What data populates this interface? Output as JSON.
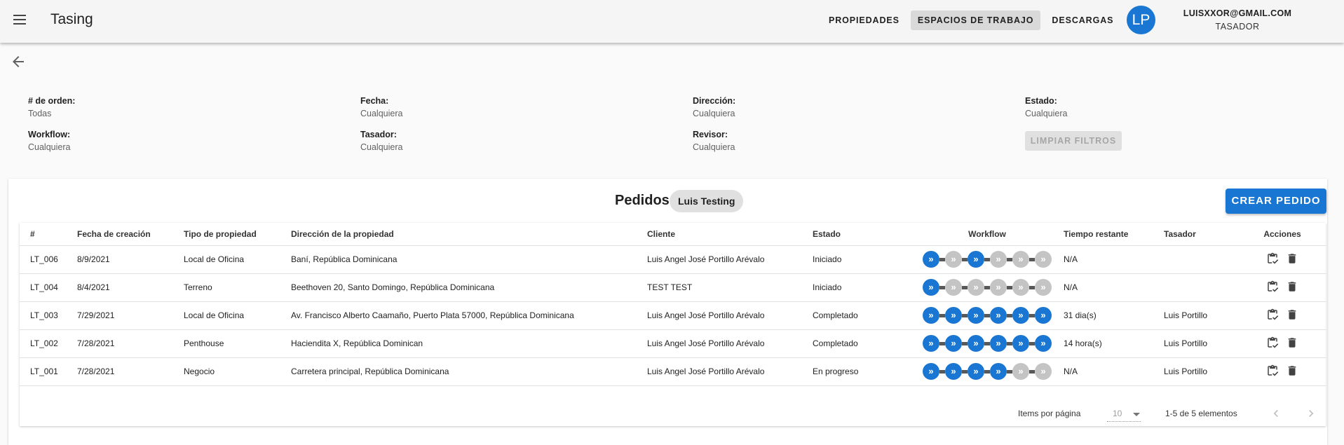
{
  "app": {
    "title": "Tasing"
  },
  "nav": {
    "items": [
      "PROPIEDADES",
      "ESPACIOS DE TRABAJO",
      "DESCARGAS"
    ],
    "active_index": 1
  },
  "user": {
    "initials": "LP",
    "email": "LUISXXOR@GMAIL.COM",
    "role": "TASADOR"
  },
  "filters": {
    "order": {
      "label": "# de orden:",
      "value": "Todas"
    },
    "date": {
      "label": "Fecha:",
      "value": "Cualquiera"
    },
    "address": {
      "label": "Dirección:",
      "value": "Cualquiera"
    },
    "status": {
      "label": "Estado:",
      "value": "Cualquiera"
    },
    "workflow": {
      "label": "Workflow:",
      "value": "Cualquiera"
    },
    "appraiser": {
      "label": "Tasador:",
      "value": "Cualquiera"
    },
    "reviewer": {
      "label": "Revisor:",
      "value": "Cualquiera"
    },
    "clear_label": "LIMPIAR FILTROS"
  },
  "orders": {
    "title": "Pedidos",
    "workspace_chip": "Luis Testing",
    "create_label": "CREAR PEDIDO",
    "columns": [
      "#",
      "Fecha de creación",
      "Tipo de propiedad",
      "Dirección de la propiedad",
      "Cliente",
      "Estado",
      "Workflow",
      "Tiempo restante",
      "Tasador",
      "Acciones"
    ],
    "workflow_step_glyph": "»",
    "rows": [
      {
        "id": "LT_006",
        "created": "8/9/2021",
        "type": "Local de Oficina",
        "address": "Baní, República Dominicana",
        "client": "Luis Angel José Portillo Arévalo",
        "status": "Iniciado",
        "workflow": [
          1,
          0,
          1,
          0,
          0,
          0
        ],
        "remaining": "N/A",
        "appraiser": ""
      },
      {
        "id": "LT_004",
        "created": "8/4/2021",
        "type": "Terreno",
        "address": "Beethoven 20, Santo Domingo, República Dominicana",
        "client": "TEST TEST",
        "status": "Iniciado",
        "workflow": [
          1,
          0,
          0,
          0,
          0,
          0
        ],
        "remaining": "N/A",
        "appraiser": ""
      },
      {
        "id": "LT_003",
        "created": "7/29/2021",
        "type": "Local de Oficina",
        "address": "Av. Francisco Alberto Caamaño, Puerto Plata 57000, República Dominicana",
        "client": "Luis Angel José Portillo Arévalo",
        "status": "Completado",
        "workflow": [
          1,
          1,
          1,
          1,
          1,
          1
        ],
        "remaining": "31 dia(s)",
        "appraiser": "Luis Portillo"
      },
      {
        "id": "LT_002",
        "created": "7/28/2021",
        "type": "Penthouse",
        "address": "Haciendita X, República Dominican",
        "client": "Luis Angel José Portillo Arévalo",
        "status": "Completado",
        "workflow": [
          1,
          1,
          1,
          1,
          1,
          1
        ],
        "remaining": "14 hora(s)",
        "appraiser": "Luis Portillo"
      },
      {
        "id": "LT_001",
        "created": "7/28/2021",
        "type": "Negocio",
        "address": "Carretera principal, República Dominicana",
        "client": "Luis Angel José Portillo Arévalo",
        "status": "En progreso",
        "workflow": [
          1,
          1,
          1,
          1,
          0,
          0
        ],
        "remaining": "N/A",
        "appraiser": "Luis Portillo"
      }
    ]
  },
  "paginator": {
    "items_label": "Items por página",
    "page_size": "10",
    "range_label": "1-5 de 5 elementos"
  },
  "colors": {
    "primary": "#1976d2",
    "step_inactive": "#c4c4c4",
    "toolbar": "#f5f5f5"
  }
}
